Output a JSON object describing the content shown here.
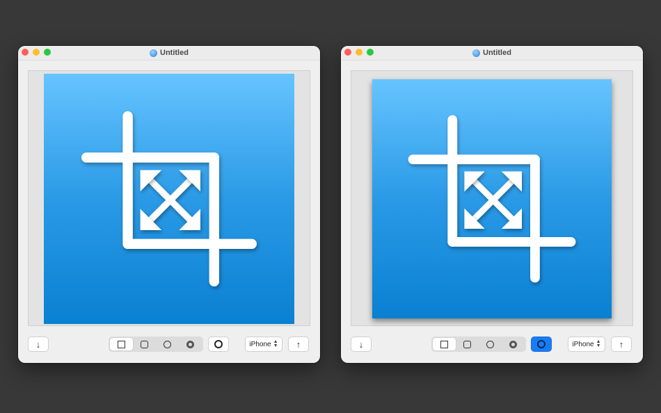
{
  "windows": [
    {
      "title": "Untitled",
      "export_arrow": "↓",
      "share_arrow": "↑",
      "device": "iPhone",
      "shape_selected": "square",
      "shadow_on": false
    },
    {
      "title": "Untitled",
      "export_arrow": "↓",
      "share_arrow": "↑",
      "device": "iPhone",
      "shape_selected": "square",
      "shadow_on": true
    }
  ],
  "icons": {
    "traffic_lights": [
      "close",
      "minimize",
      "zoom"
    ],
    "shapes": [
      "square-icon",
      "rounded-square-icon",
      "circle-icon",
      "ring-icon"
    ],
    "artwork": "crop-resize-icon"
  },
  "colors": {
    "desktop": "#383838",
    "artwork_top": "#66c4ff",
    "artwork_bottom": "#0a80d2",
    "accent": "#1a7cf5"
  }
}
